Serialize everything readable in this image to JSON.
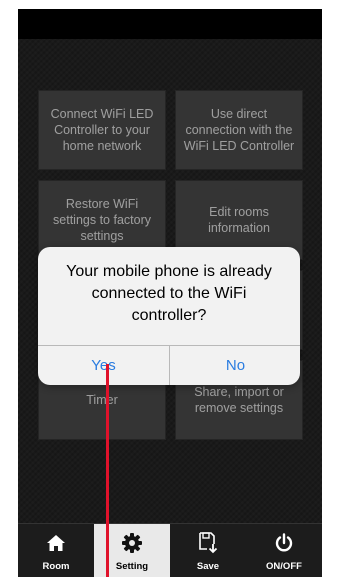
{
  "tiles": {
    "connect_wifi": "Connect WiFi LED\nController to your\nhome network",
    "direct_connection": "Use direct\nconnection with the\nWiFi LED Controller",
    "restore_wifi": "Restore WiFi\nsettings to factory\nsettings",
    "edit_rooms": "Edit rooms\ninformation",
    "timer": "Timer",
    "share_settings": "Share, import or\nremove settings"
  },
  "dialog": {
    "message": "Your mobile phone is already\nconnected to the WiFi\ncontroller?",
    "yes_label": "Yes",
    "no_label": "No"
  },
  "tabbar": {
    "items": [
      {
        "label": "Room",
        "icon": "home-icon"
      },
      {
        "label": "Setting",
        "icon": "gear-icon"
      },
      {
        "label": "Save",
        "icon": "save-icon"
      },
      {
        "label": "ON/OFF",
        "icon": "power-icon"
      }
    ],
    "active": "Setting"
  },
  "colors": {
    "dialog_button": "#2a7ce0",
    "marker": "#e0122b",
    "active_tab_bg": "#e9e9e9"
  }
}
